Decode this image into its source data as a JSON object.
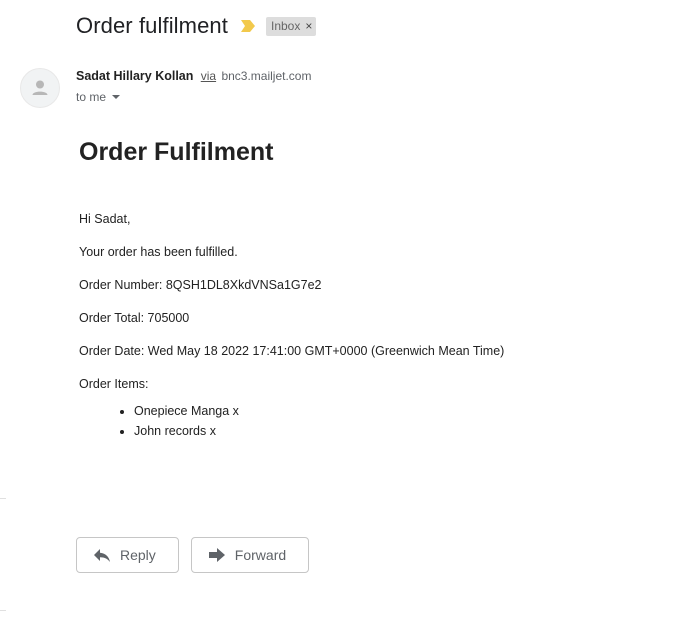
{
  "header": {
    "subject": "Order fulfilment",
    "label": "Inbox",
    "label_remove": "×"
  },
  "sender": {
    "name": "Sadat Hillary Kollan",
    "via": "via",
    "domain": "bnc3.mailjet.com",
    "recipient": "to me"
  },
  "message": {
    "title": "Order Fulfilment",
    "greeting": "Hi Sadat,",
    "status": "Your order has been fulfilled.",
    "order_number": "Order Number: 8QSH1DL8XkdVNSa1G7e2",
    "order_total": "Order Total: 705000",
    "order_date": "Order Date: Wed May 18 2022 17:41:00 GMT+0000 (Greenwich Mean Time)",
    "items_label": "Order Items:",
    "items": [
      "Onepiece Manga x",
      "John records x"
    ]
  },
  "actions": {
    "reply": "Reply",
    "forward": "Forward"
  },
  "colors": {
    "importance_marker": "#f2c94c",
    "label_chip_bg": "#dddddd",
    "button_border": "#c6c6c6"
  },
  "icons": {
    "importance": "importance-marker-icon",
    "avatar": "person-icon",
    "details": "caret-down-icon",
    "reply": "reply-arrow-icon",
    "forward": "forward-arrow-icon"
  }
}
